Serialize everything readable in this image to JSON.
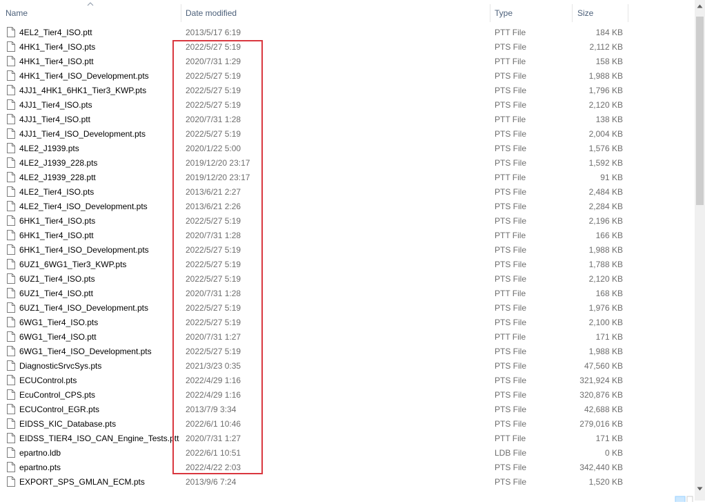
{
  "columns": {
    "name": "Name",
    "date_modified": "Date modified",
    "type": "Type",
    "size": "Size"
  },
  "sort": {
    "column": "name",
    "direction": "ascending"
  },
  "highlight_color": "#d9363e",
  "files": [
    {
      "name": "4EL2_Tier4_ISO.ptt",
      "date": "2013/5/17 6:19",
      "type": "PTT File",
      "size": "184 KB"
    },
    {
      "name": "4HK1_Tier4_ISO.pts",
      "date": "2022/5/27 5:19",
      "type": "PTS File",
      "size": "2,112 KB"
    },
    {
      "name": "4HK1_Tier4_ISO.ptt",
      "date": "2020/7/31 1:29",
      "type": "PTT File",
      "size": "158 KB"
    },
    {
      "name": "4HK1_Tier4_ISO_Development.pts",
      "date": "2022/5/27 5:19",
      "type": "PTS File",
      "size": "1,988 KB"
    },
    {
      "name": "4JJ1_4HK1_6HK1_Tier3_KWP.pts",
      "date": "2022/5/27 5:19",
      "type": "PTS File",
      "size": "1,796 KB"
    },
    {
      "name": "4JJ1_Tier4_ISO.pts",
      "date": "2022/5/27 5:19",
      "type": "PTS File",
      "size": "2,120 KB"
    },
    {
      "name": "4JJ1_Tier4_ISO.ptt",
      "date": "2020/7/31 1:28",
      "type": "PTT File",
      "size": "138 KB"
    },
    {
      "name": "4JJ1_Tier4_ISO_Development.pts",
      "date": "2022/5/27 5:19",
      "type": "PTS File",
      "size": "2,004 KB"
    },
    {
      "name": "4LE2_J1939.pts",
      "date": "2020/1/22 5:00",
      "type": "PTS File",
      "size": "1,576 KB"
    },
    {
      "name": "4LE2_J1939_228.pts",
      "date": "2019/12/20 23:17",
      "type": "PTS File",
      "size": "1,592 KB"
    },
    {
      "name": "4LE2_J1939_228.ptt",
      "date": "2019/12/20 23:17",
      "type": "PTT File",
      "size": "91 KB"
    },
    {
      "name": "4LE2_Tier4_ISO.pts",
      "date": "2013/6/21 2:27",
      "type": "PTS File",
      "size": "2,484 KB"
    },
    {
      "name": "4LE2_Tier4_ISO_Development.pts",
      "date": "2013/6/21 2:26",
      "type": "PTS File",
      "size": "2,284 KB"
    },
    {
      "name": "6HK1_Tier4_ISO.pts",
      "date": "2022/5/27 5:19",
      "type": "PTS File",
      "size": "2,196 KB"
    },
    {
      "name": "6HK1_Tier4_ISO.ptt",
      "date": "2020/7/31 1:28",
      "type": "PTT File",
      "size": "166 KB"
    },
    {
      "name": "6HK1_Tier4_ISO_Development.pts",
      "date": "2022/5/27 5:19",
      "type": "PTS File",
      "size": "1,988 KB"
    },
    {
      "name": "6UZ1_6WG1_Tier3_KWP.pts",
      "date": "2022/5/27 5:19",
      "type": "PTS File",
      "size": "1,788 KB"
    },
    {
      "name": "6UZ1_Tier4_ISO.pts",
      "date": "2022/5/27 5:19",
      "type": "PTS File",
      "size": "2,120 KB"
    },
    {
      "name": "6UZ1_Tier4_ISO.ptt",
      "date": "2020/7/31 1:28",
      "type": "PTT File",
      "size": "168 KB"
    },
    {
      "name": "6UZ1_Tier4_ISO_Development.pts",
      "date": "2022/5/27 5:19",
      "type": "PTS File",
      "size": "1,976 KB"
    },
    {
      "name": "6WG1_Tier4_ISO.pts",
      "date": "2022/5/27 5:19",
      "type": "PTS File",
      "size": "2,100 KB"
    },
    {
      "name": "6WG1_Tier4_ISO.ptt",
      "date": "2020/7/31 1:27",
      "type": "PTT File",
      "size": "171 KB"
    },
    {
      "name": "6WG1_Tier4_ISO_Development.pts",
      "date": "2022/5/27 5:19",
      "type": "PTS File",
      "size": "1,988 KB"
    },
    {
      "name": "DiagnosticSrvcSys.pts",
      "date": "2021/3/23 0:35",
      "type": "PTS File",
      "size": "47,560 KB"
    },
    {
      "name": "ECUControl.pts",
      "date": "2022/4/29 1:16",
      "type": "PTS File",
      "size": "321,924 KB"
    },
    {
      "name": "EcuControl_CPS.pts",
      "date": "2022/4/29 1:16",
      "type": "PTS File",
      "size": "320,876 KB"
    },
    {
      "name": "ECUControl_EGR.pts",
      "date": "2013/7/9 3:34",
      "type": "PTS File",
      "size": "42,688 KB"
    },
    {
      "name": "EIDSS_KIC_Database.pts",
      "date": "2022/6/1 10:46",
      "type": "PTS File",
      "size": "279,016 KB"
    },
    {
      "name": "EIDSS_TIER4_ISO_CAN_Engine_Tests.ptt",
      "date": "2020/7/31 1:27",
      "type": "PTT File",
      "size": "171 KB"
    },
    {
      "name": "epartno.ldb",
      "date": "2022/6/1 10:51",
      "type": "LDB File",
      "size": "0 KB"
    },
    {
      "name": "epartno.pts",
      "date": "2022/4/22 2:03",
      "type": "PTS File",
      "size": "342,440 KB"
    },
    {
      "name": "EXPORT_SPS_GMLAN_ECM.pts",
      "date": "2013/9/6 7:24",
      "type": "PTS File",
      "size": "1,520 KB"
    }
  ]
}
